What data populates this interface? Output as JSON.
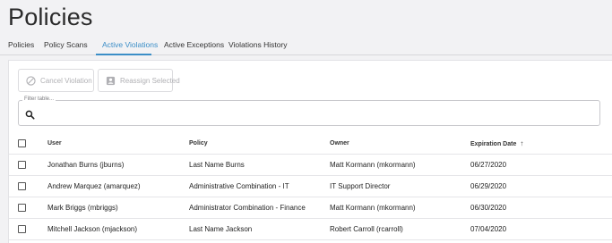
{
  "page": {
    "title": "Policies"
  },
  "tabs": [
    {
      "label": "Policies"
    },
    {
      "label": "Policy Scans"
    },
    {
      "label": "Active Violations"
    },
    {
      "label": "Active Exceptions"
    },
    {
      "label": "Violations History"
    }
  ],
  "active_tab": "Active Violations",
  "toolbar": {
    "cancel_label": "Cancel Violation",
    "reassign_label": "Reassign Selected"
  },
  "filter": {
    "legend": "Filter table...",
    "value": "",
    "placeholder": ""
  },
  "table": {
    "headers": {
      "user": "User",
      "policy": "Policy",
      "owner": "Owner",
      "expiration": "Expiration Date"
    },
    "sort_indicator": "↑",
    "rows": [
      {
        "user": "Jonathan Burns (jburns)",
        "policy": "Last Name Burns",
        "owner": "Matt Kormann (mkormann)",
        "expiration": "06/27/2020"
      },
      {
        "user": "Andrew Marquez (amarquez)",
        "policy": "Administrative Combination - IT",
        "owner": "IT Support Director",
        "expiration": "06/29/2020"
      },
      {
        "user": "Mark Briggs (mbriggs)",
        "policy": "Administrator Combination - Finance",
        "owner": "Matt Kormann (mkormann)",
        "expiration": "06/30/2020"
      },
      {
        "user": "Mitchell Jackson (mjackson)",
        "policy": "Last Name Jackson",
        "owner": "Robert Carroll (rcarroll)",
        "expiration": "07/04/2020"
      }
    ]
  },
  "colors": {
    "accent": "#3b8ec7",
    "background": "#f2f2f4",
    "card": "#ffffff"
  },
  "icons": {
    "cancel": "cancel-circle-icon",
    "reassign": "reassign-user-icon",
    "filter": "search-icon",
    "sort": "sort-ascending-icon"
  }
}
